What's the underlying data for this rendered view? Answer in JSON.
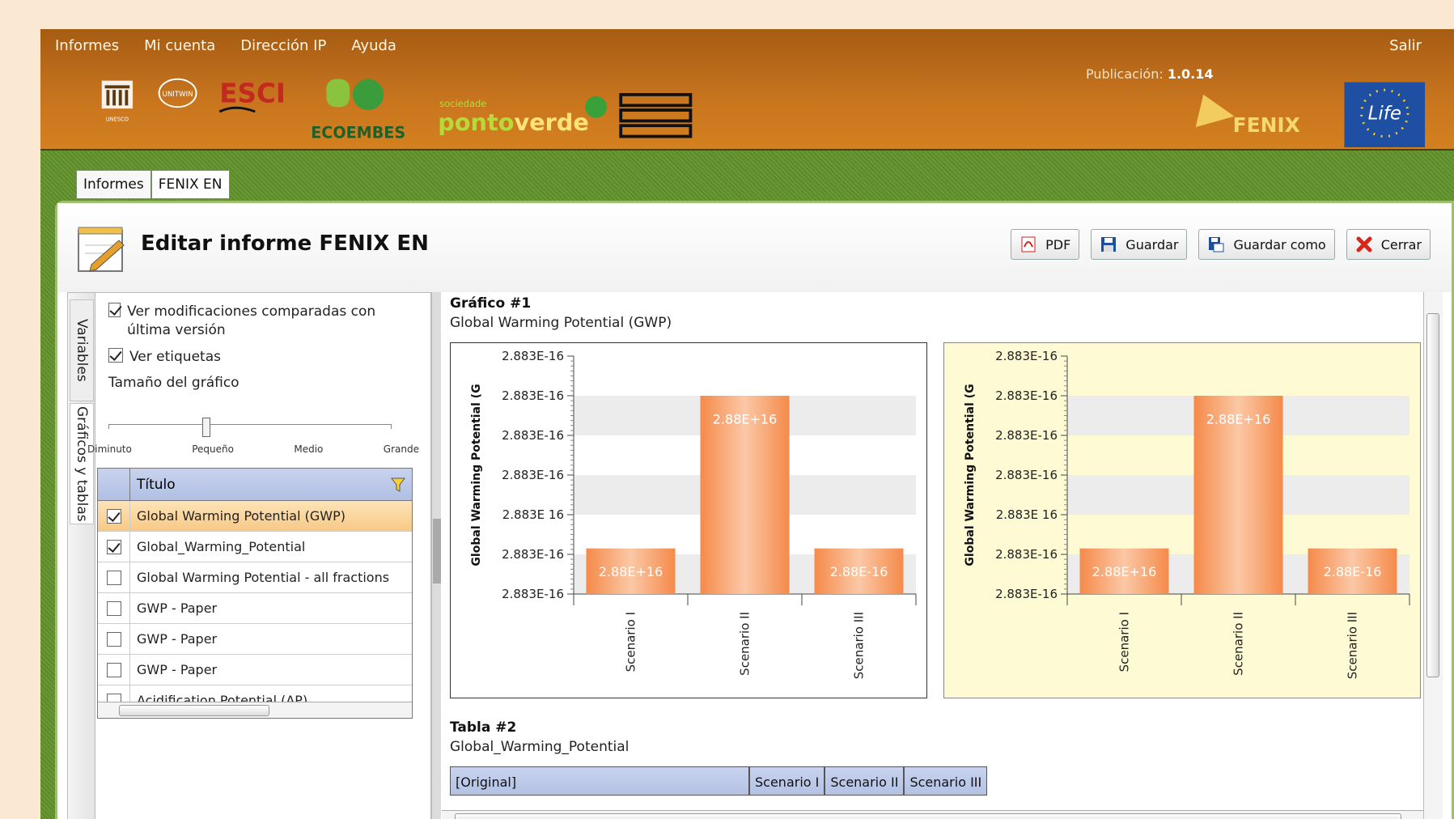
{
  "menu": {
    "items": [
      "Informes",
      "Mi cuenta",
      "Dirección IP",
      "Ayuda"
    ],
    "logout": "Salir"
  },
  "version": {
    "label": "Publicación:",
    "value": "1.0.14"
  },
  "logos": {
    "unesco": "UNESCO",
    "unitwin": "UNITWIN",
    "esci": "ESCI",
    "ecoembes": "ECOEMBES",
    "sociedade": "sociedade",
    "ponto": "ponto",
    "verde": "verde",
    "fenix": "FENIX",
    "life": "Life"
  },
  "tabs": [
    "Informes",
    "FENIX EN"
  ],
  "panel": {
    "title": "Editar informe FENIX EN"
  },
  "toolbar": {
    "pdf": "PDF",
    "save": "Guardar",
    "save_as": "Guardar como",
    "close": "Cerrar"
  },
  "vtabs": {
    "variables": "Variables",
    "charts": "Gráficos y tablas"
  },
  "options": {
    "compare": "Ver modificaciones comparadas con última versión",
    "labels": "Ver etiquetas",
    "size_label": "Tamaño del gráfico",
    "size_value": "Pequeño",
    "ticks": [
      "Diminuto",
      "Pequeño",
      "Medio",
      "Grande"
    ]
  },
  "grid": {
    "header": "Título",
    "rows": [
      {
        "checked": true,
        "title": "Global Warming Potential (GWP)",
        "selected": true
      },
      {
        "checked": true,
        "title": "Global_Warming_Potential",
        "selected": false
      },
      {
        "checked": false,
        "title": "Global Warming Potential - all fractions",
        "selected": false
      },
      {
        "checked": false,
        "title": "GWP - Paper",
        "selected": false
      },
      {
        "checked": false,
        "title": "GWP - Paper",
        "selected": false
      },
      {
        "checked": false,
        "title": "GWP - Paper",
        "selected": false
      },
      {
        "checked": false,
        "title": "Acidification Potential (AP)",
        "selected": false
      }
    ]
  },
  "section1": {
    "title": "Gráfico #1",
    "subtitle": "Global Warming Potential (GWP)"
  },
  "section2": {
    "title": "Tabla #2",
    "subtitle": "Global_Warming_Potential"
  },
  "table2": {
    "headers": [
      "[Original]",
      "Scenario I",
      "Scenario II",
      "Scenario III"
    ]
  },
  "chart_data": [
    {
      "type": "bar",
      "title": "",
      "ylabel": "Global Warming Potential (G",
      "ytick_labels": [
        "2.883E-16",
        "2.883E-16",
        "2.883E-16",
        "2.883E-16",
        "2.883E 16",
        "2.883E-16",
        "2.883E-16"
      ],
      "categories": [
        "Scenario I",
        "Scenario II",
        "Scenario III"
      ],
      "values": [
        0.23,
        1.0,
        0.23
      ],
      "data_labels": [
        "2.88E+16",
        "2.88E+16",
        "2.88E-16"
      ],
      "bar_color": "#f58a4a",
      "background": "#ffffff"
    },
    {
      "type": "bar",
      "title": "",
      "ylabel": "Global Warming Potential (G",
      "ytick_labels": [
        "2.883E-16",
        "2.883E-16",
        "2.883E-16",
        "2.883E-16",
        "2.883E 16",
        "2.883E-16",
        "2.883E-16"
      ],
      "categories": [
        "Scenario I",
        "Scenario II",
        "Scenario III"
      ],
      "values": [
        0.23,
        1.0,
        0.23
      ],
      "data_labels": [
        "2.88E+16",
        "2.88E+16",
        "2.88E-16"
      ],
      "bar_color": "#f58a4a",
      "background": "#fefbd4"
    }
  ]
}
